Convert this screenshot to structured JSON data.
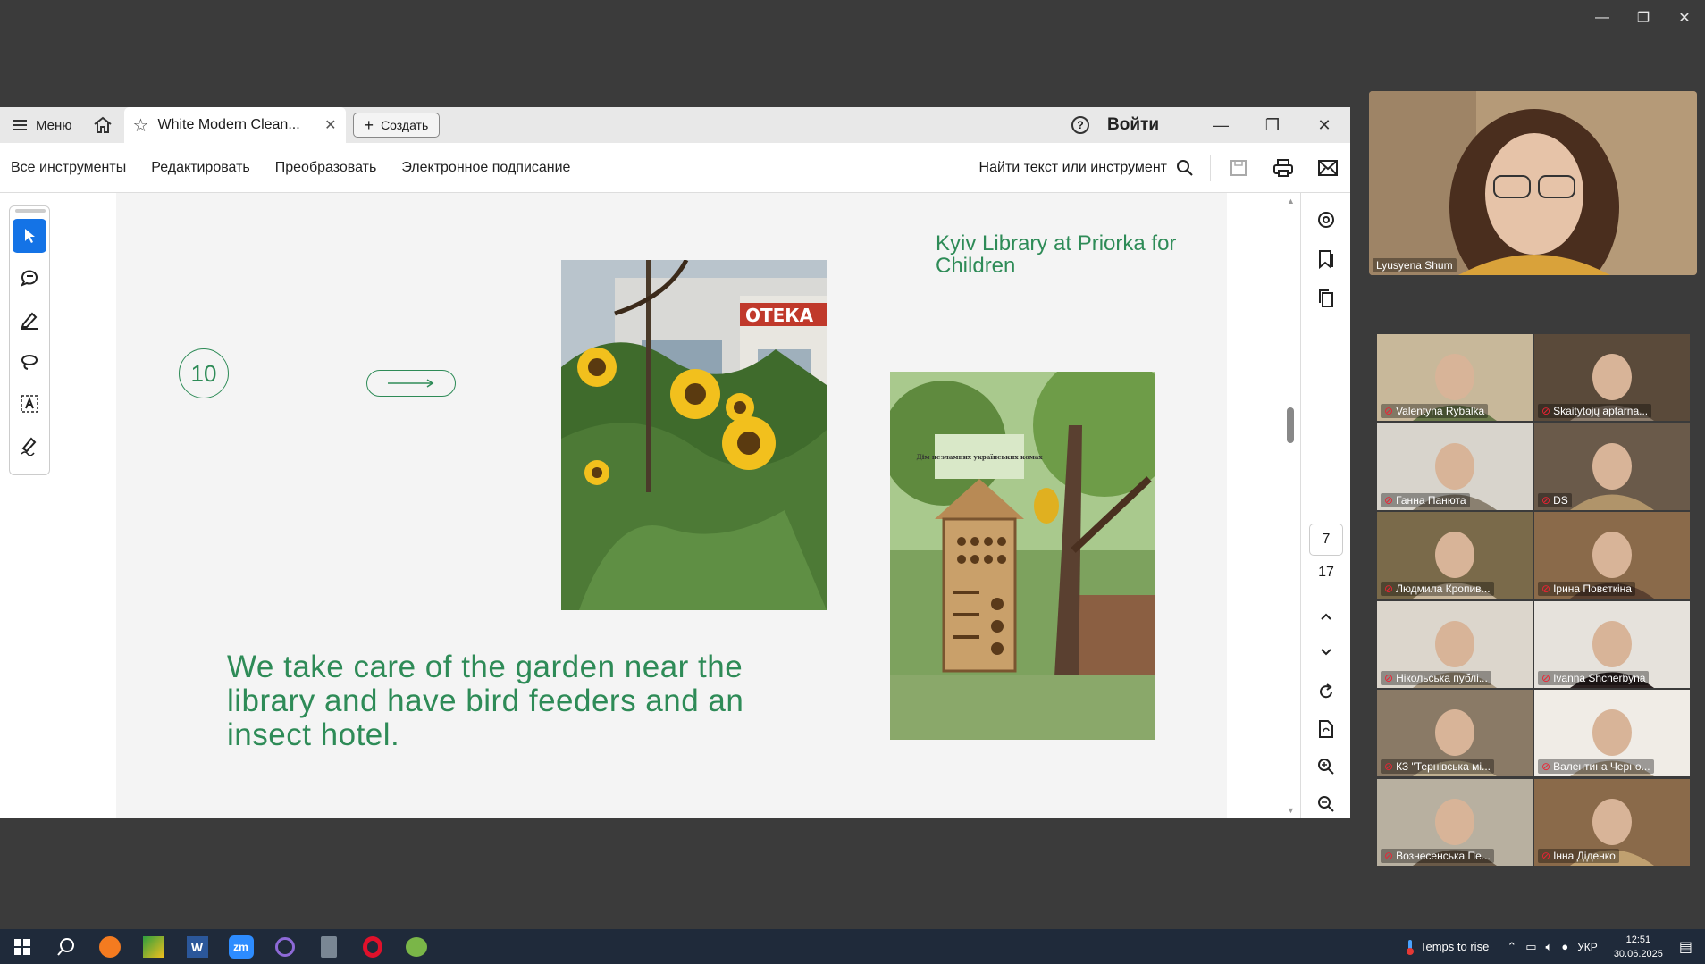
{
  "window": {
    "tab_title": "White Modern Clean...",
    "menu_label": "Меню",
    "create_label": "Создать",
    "login_label": "Войти"
  },
  "toolbar": {
    "items": [
      "Все инструменты",
      "Редактировать",
      "Преобразовать",
      "Электронное подписание"
    ],
    "search_label": "Найти текст или инструмент"
  },
  "navigation": {
    "current_page": "7",
    "total_pages": "17"
  },
  "slide": {
    "number": "10",
    "title": "Kyiv Library at Priorka for Children",
    "text": "We take care of the garden near the library and have bird feeders and an insect hotel.",
    "photo1_sign": "ОТЕКА",
    "photo2_sign": "Дім незламних українських комах"
  },
  "zoom": {
    "speaker": "Lyusyena Shum",
    "participants": [
      "Valentyna Rybalka",
      "Skaitytojų aptarna...",
      "Ганна Панюта",
      "DS",
      "Людмила Кропив...",
      "Ірина Повєткіна",
      "Нікольська публі...",
      "Ivanna Shcherbyna",
      "КЗ \"Тернівська мі...",
      "Валентина Черно...",
      "Вознесенська Пе...",
      "Інна Діденко"
    ]
  },
  "taskbar": {
    "weather": "Temps to rise",
    "language": "УКР",
    "time": "12:51",
    "date": "30.06.2025"
  },
  "colors": {
    "accent_green": "#2e8b57",
    "active_tool": "#1473e6",
    "taskbar": "#1f2a3a"
  }
}
